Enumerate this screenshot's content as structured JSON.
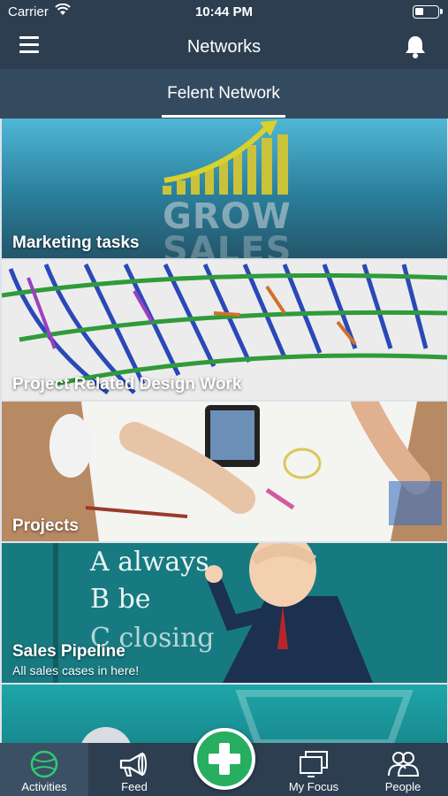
{
  "status_bar": {
    "carrier": "Carrier",
    "time": "10:44 PM"
  },
  "header": {
    "title": "Networks"
  },
  "tabs": {
    "active_label": "Felent Network"
  },
  "cards": [
    {
      "title": "Marketing tasks",
      "image_text_top": "GROW",
      "image_text_bottom": "SALES"
    },
    {
      "title": "Project Related Design Work"
    },
    {
      "title": "Projects"
    },
    {
      "title": "Sales Pipeline",
      "subtitle": "All sales cases in here!",
      "chalk_line_1": "A always",
      "chalk_line_2": "B be",
      "chalk_line_3": "C closing"
    }
  ],
  "tabbar": {
    "items": [
      {
        "label": "Activities",
        "icon": "tennis-ball-icon",
        "active": true
      },
      {
        "label": "Feed",
        "icon": "megaphone-icon"
      },
      {
        "label": "My Focus",
        "icon": "monitor-icon"
      },
      {
        "label": "People",
        "icon": "people-icon"
      }
    ],
    "fab_icon": "plus-icon"
  },
  "colors": {
    "nav": "#2c3e50",
    "tab_strip": "#344a5e",
    "accent_green": "#27ae60"
  }
}
